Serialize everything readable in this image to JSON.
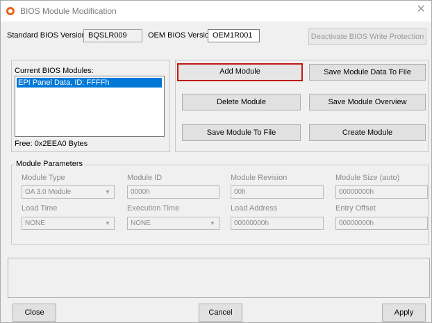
{
  "window": {
    "title": "BIOS Module Modification"
  },
  "versions": {
    "standard_label": "Standard BIOS Version:",
    "standard_value": "BQSLR009",
    "oem_label": "OEM BIOS Version:",
    "oem_value": "OEM1R001",
    "deactivate_label": "Deactivate BIOS Write Protection"
  },
  "modules": {
    "label": "Current BIOS Modules:",
    "items": [
      "EPI Panel Data, ID: FFFFh"
    ],
    "free": "Free: 0x2EEA0 Bytes"
  },
  "actions": {
    "add": "Add  Module",
    "save_data": "Save Module Data To File",
    "delete": "Delete Module",
    "save_overview": "Save Module Overview",
    "save_to_file": "Save Module To File",
    "create": "Create Module"
  },
  "params": {
    "title": "Module Parameters",
    "type_label": "Module Type",
    "type_value": "OA 3.0 Module",
    "id_label": "Module ID",
    "id_value": "0000h",
    "revision_label": "Module Revision",
    "revision_value": "00h",
    "size_label": "Module Size (auto)",
    "size_value": "00000000h",
    "load_time_label": "Load Time",
    "load_time_value": "NONE",
    "exec_time_label": "Execution Time",
    "exec_time_value": "NONE",
    "load_addr_label": "Load Address",
    "load_addr_value": "00000000h",
    "entry_label": "Entry Offset",
    "entry_value": "00000000h"
  },
  "footer": {
    "close": "Close",
    "cancel": "Cancel",
    "apply": "Apply"
  },
  "colors": {
    "accent_selection": "#0078d7",
    "focus_border": "#c01818",
    "app_icon": "#e8621c"
  }
}
